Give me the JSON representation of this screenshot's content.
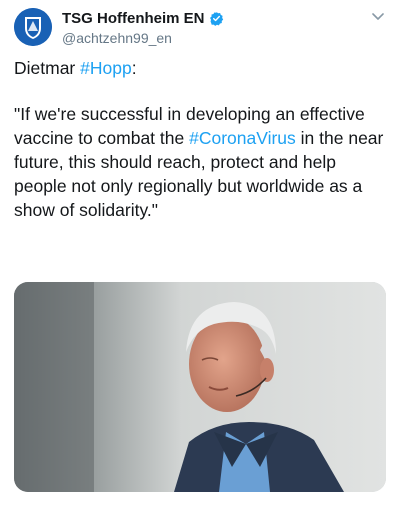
{
  "tweet": {
    "display_name": "TSG Hoffenheim EN",
    "handle": "@achtzehn99_en",
    "verified": true,
    "line1_prefix": "Dietmar ",
    "hashtag_hopp": "#Hopp",
    "line1_suffix": ":",
    "quote_part1": "\"If we're successful in developing an effective vaccine to combat the ",
    "hashtag_corona": "#CoronaVirus",
    "quote_part2": " in the near future, this should reach, protect and help people not only regionally but worldwide as a show of solidarity.\""
  },
  "icons": {
    "avatar": "club-crest-icon",
    "verified": "verified-badge-icon",
    "menu": "chevron-down-icon"
  },
  "colors": {
    "link": "#1da1f2",
    "crest_blue": "#1961b5",
    "text": "#14171a",
    "secondary": "#657786"
  }
}
